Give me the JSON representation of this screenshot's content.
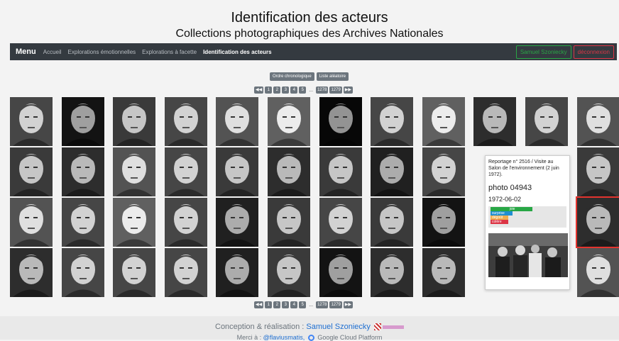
{
  "header": {
    "title": "Identification des acteurs",
    "subtitle": "Collections photographiques des Archives Nationales"
  },
  "navbar": {
    "brand": "Menu",
    "links": [
      "Accueil",
      "Explorations émotionnelles",
      "Explorations à facette",
      "Identification des acteurs"
    ],
    "active_index": 3,
    "user_button": "Samuel Szoniecky",
    "logout_button": "déconnexion"
  },
  "sort_buttons": [
    "Ordre chronologique",
    "Liste aléatoire"
  ],
  "pagination": {
    "first_icon": "first-page-icon",
    "pages": [
      "1",
      "2",
      "3",
      "4",
      "5"
    ],
    "ellipsis": "...",
    "last_pages": [
      "1278",
      "1279"
    ],
    "next_icon": "next-page-icon"
  },
  "grid": {
    "rows": 4,
    "cols": 12,
    "selected_cell": [
      2,
      11
    ],
    "tone_by_cell": [
      [
        0.55,
        0.35,
        0.5,
        0.55,
        0.6,
        0.65,
        0.3,
        0.55,
        0.65,
        0.45,
        0.55,
        0.6
      ],
      [
        0.5,
        0.45,
        0.6,
        0.55,
        0.5,
        0.45,
        0.5,
        0.4,
        0.55,
        0.55,
        0.5,
        0.5
      ],
      [
        0.6,
        0.55,
        0.65,
        0.55,
        0.4,
        0.5,
        0.55,
        0.5,
        0.35,
        0.5,
        0.45,
        0.45
      ],
      [
        0.45,
        0.55,
        0.55,
        0.55,
        0.4,
        0.5,
        0.35,
        0.45,
        0.45,
        0.55,
        0.55,
        0.6
      ]
    ]
  },
  "popup": {
    "report": "Reportage n° 2516 / Visite au Salon de l'environnement (2 juin 1972).",
    "photo_id": "photo 04943",
    "date": "1972-06-02",
    "emotions": [
      {
        "label": "joie",
        "color": "#28a745",
        "level": 0.55
      },
      {
        "label": "surprise",
        "color": "#1f8fd1",
        "level": 0.28
      },
      {
        "label": "dégoût",
        "color": "#f0ad4e",
        "level": 0.22
      },
      {
        "label": "colère",
        "color": "#dc3545",
        "level": 0.22
      }
    ]
  },
  "footer": {
    "credit_prefix": "Conception & réalisation :",
    "credit_name": "Samuel Szoniecky",
    "thanks_prefix": "Merci à :",
    "thanks_handle": "@flaviusmatis,",
    "thanks_sponsor": "Google Cloud Platform"
  }
}
